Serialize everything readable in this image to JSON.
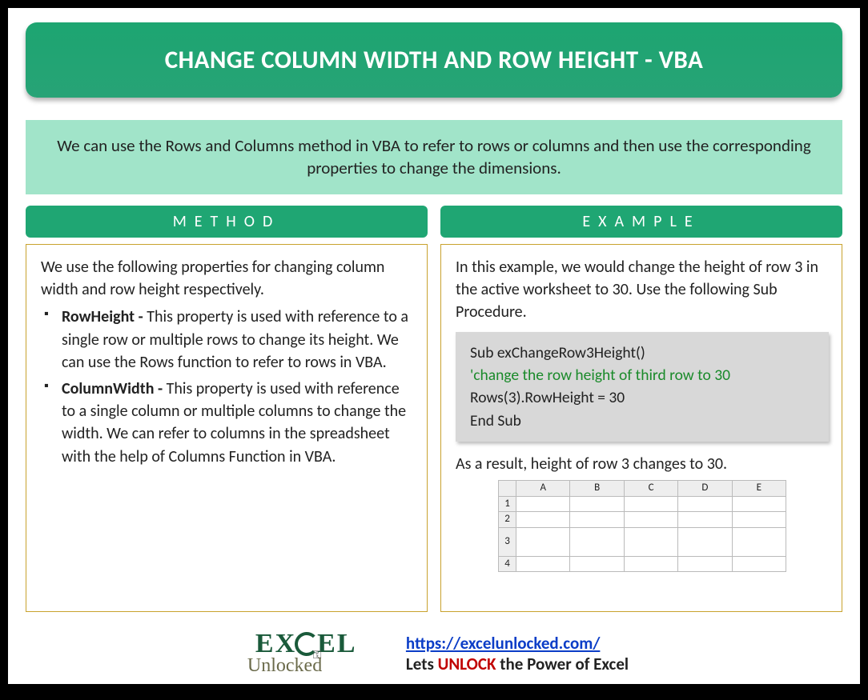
{
  "title": "CHANGE COLUMN WIDTH AND ROW HEIGHT - VBA",
  "description": "We can use the Rows and Columns method in VBA to refer to rows or columns and then use the corresponding properties to change the dimensions.",
  "method": {
    "header": "METHOD",
    "intro": "We use the following properties for changing column width and row height respectively.",
    "items": [
      {
        "name": "RowHeight - ",
        "text": "This property is used with reference to a single row or multiple rows to change its height. We can use the Rows function to refer to rows in VBA."
      },
      {
        "name": "ColumnWidth - ",
        "text": "This property is used with reference to a single column or multiple columns to change the width. We can refer to columns in the spreadsheet with the help of Columns Function in VBA."
      }
    ]
  },
  "example": {
    "header": "EXAMPLE",
    "intro": "In this example, we would change the height of row 3 in the active worksheet to 30. Use the following Sub Procedure.",
    "code": {
      "line1": "Sub exChangeRow3Height()",
      "line2": "'change the row height of third row to 30",
      "line3": "Rows(3).RowHeight = 30",
      "line4": "End Sub"
    },
    "result": "As a result, height of row 3 changes to 30.",
    "sheet": {
      "cols": [
        "A",
        "B",
        "C",
        "D",
        "E"
      ],
      "rows": [
        "1",
        "2",
        "3",
        "4"
      ]
    }
  },
  "footer": {
    "logo_top_1": "EX",
    "logo_top_2": "EL",
    "logo_bot": "Unlocked",
    "url": "https://excelunlocked.com/",
    "tag_pre": "Lets ",
    "tag_unlock": "UNLOCK",
    "tag_post": " the Power of Excel"
  }
}
